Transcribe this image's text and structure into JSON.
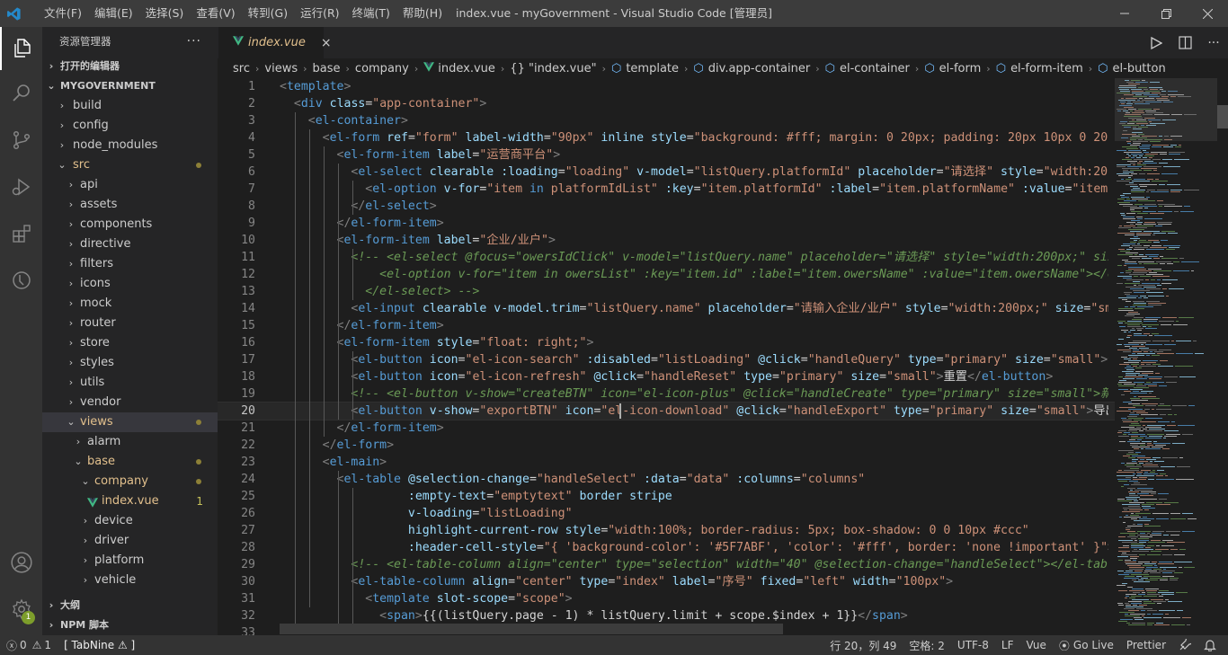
{
  "window": {
    "title": "index.vue - myGovernment - Visual Studio Code [管理员]"
  },
  "menu": [
    "文件(F)",
    "编辑(E)",
    "选择(S)",
    "查看(V)",
    "转到(G)",
    "运行(R)",
    "终端(T)",
    "帮助(H)"
  ],
  "activity": {
    "badge": "1"
  },
  "sidebar": {
    "title": "资源管理器",
    "more": "···",
    "open_editors": "打开的编辑器",
    "project": "MYGOVERNMENT",
    "outline": "大纲",
    "npm": "NPM 脚本",
    "tree": [
      {
        "label": "build"
      },
      {
        "label": "config"
      },
      {
        "label": "node_modules"
      },
      {
        "label": "src"
      },
      {
        "label": "api"
      },
      {
        "label": "assets"
      },
      {
        "label": "components"
      },
      {
        "label": "directive"
      },
      {
        "label": "filters"
      },
      {
        "label": "icons"
      },
      {
        "label": "mock"
      },
      {
        "label": "router"
      },
      {
        "label": "store"
      },
      {
        "label": "styles"
      },
      {
        "label": "utils"
      },
      {
        "label": "vendor"
      },
      {
        "label": "views"
      },
      {
        "label": "alarm"
      },
      {
        "label": "base"
      },
      {
        "label": "company"
      },
      {
        "label": "index.vue",
        "count": "1"
      },
      {
        "label": "device"
      },
      {
        "label": "driver"
      },
      {
        "label": "platform"
      },
      {
        "label": "vehicle"
      }
    ]
  },
  "tab": {
    "label": "index.vue",
    "close": "×"
  },
  "breadcrumb": [
    "src",
    "views",
    "base",
    "company",
    "index.vue",
    "{} \"index.vue\"",
    "template",
    "div.app-container",
    "el-container",
    "el-form",
    "el-form-item",
    "el-button"
  ],
  "editor": {
    "current_line": 20
  },
  "status": {
    "errors": "0",
    "warnings": "1",
    "tabnine": "[ TabNine ⚠ ]",
    "position": "行 20，列 49",
    "spaces": "空格: 2",
    "encoding": "UTF-8",
    "eol": "LF",
    "language": "Vue",
    "golive": "Go Live",
    "prettier": "Prettier"
  },
  "colors": {
    "accent": "#007acc",
    "vue_green": "#41b883",
    "modified": "#e2c08d"
  }
}
